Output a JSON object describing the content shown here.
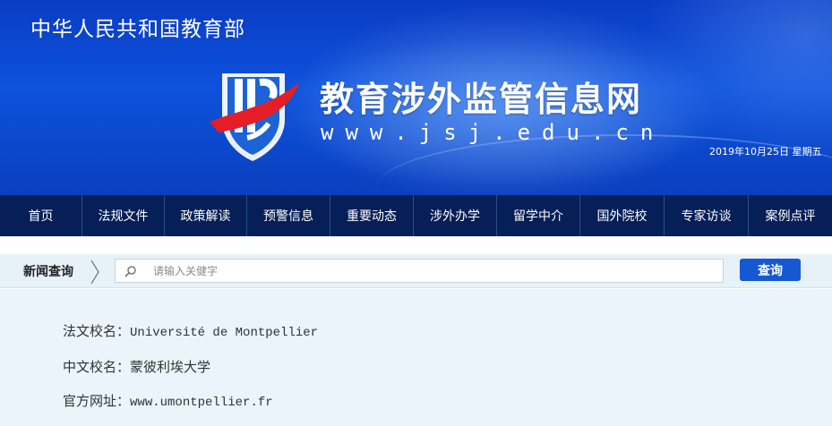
{
  "header": {
    "ministry": "中华人民共和国教育部",
    "site_name": "教育涉外监管信息网",
    "site_url": "www.jsj.edu.cn",
    "date": "2019年10月25日 星期五",
    "colors": {
      "banner": "#0d52dc",
      "logo_blue": "#1b63d6",
      "logo_red": "#e51e26"
    }
  },
  "nav": {
    "items": [
      "首页",
      "法规文件",
      "政策解读",
      "预警信息",
      "重要动态",
      "涉外办学",
      "留学中介",
      "国外院校",
      "专家访谈",
      "案例点评"
    ],
    "color": "#061f57"
  },
  "search": {
    "label": "新闻查询",
    "placeholder": "请输入关健字",
    "value": "",
    "button_label": "查询",
    "button_color": "#1658d1",
    "icon": "search-icon"
  },
  "school": {
    "fr_label": "法文校名：",
    "fr_name": "Université de Montpellier",
    "cn_label": "中文校名：",
    "cn_name": "蒙彼利埃大学",
    "url_label": "官方网址：",
    "url": "www.umontpellier.fr"
  }
}
